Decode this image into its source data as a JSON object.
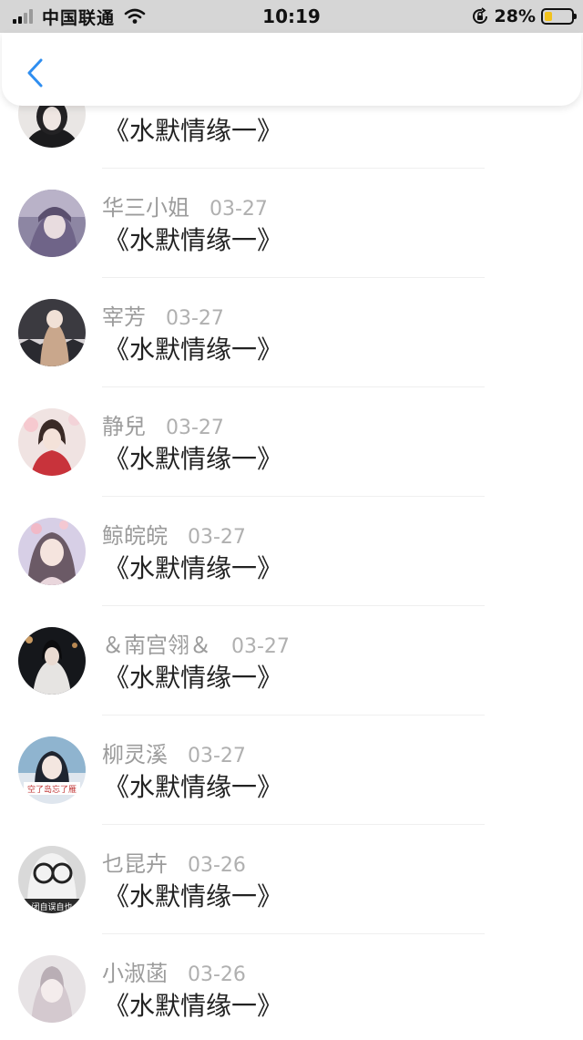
{
  "status_bar": {
    "carrier": "中国联通",
    "time": "10:19",
    "battery_percent": "28%",
    "battery_level": 0.28,
    "icons": [
      "signal-icon",
      "wifi-icon",
      "rotation-lock-icon",
      "battery-icon"
    ]
  },
  "nav": {
    "back_icon": "chevron-left-icon",
    "accent_color": "#2f8ef0"
  },
  "colors": {
    "name_text": "#9c9c9c",
    "date_text": "#b0b0b0",
    "message_text": "#222222",
    "status_bar_bg": "#d6d6d6"
  },
  "list": {
    "items": [
      {
        "name": "",
        "date": "",
        "message": "《水默情缘一》"
      },
      {
        "name": "华三小姐",
        "date": "03-27",
        "message": "《水默情缘一》"
      },
      {
        "name": "宰芳",
        "date": "03-27",
        "message": "《水默情缘一》"
      },
      {
        "name": "静兒",
        "date": "03-27",
        "message": "《水默情缘一》"
      },
      {
        "name": "鲸皖皖",
        "date": "03-27",
        "message": "《水默情缘一》"
      },
      {
        "name": "＆南宫翎＆",
        "date": "03-27",
        "message": "《水默情缘一》"
      },
      {
        "name": "柳灵溪",
        "date": "03-27",
        "message": "《水默情缘一》",
        "avatar_caption": "空了岛忘了雁"
      },
      {
        "name": "乜昆卉",
        "date": "03-26",
        "message": "《水默情缘一》",
        "avatar_caption": "闭自误自也"
      },
      {
        "name": "小淑菡",
        "date": "03-26",
        "message": "《水默情缘一》"
      }
    ]
  }
}
